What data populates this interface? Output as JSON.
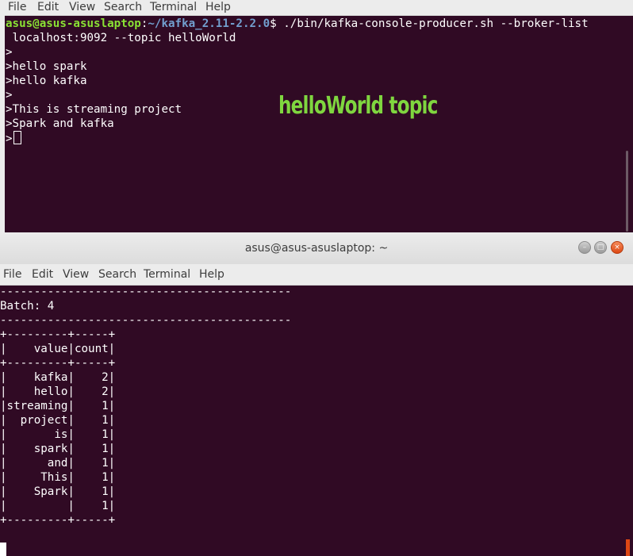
{
  "top_terminal": {
    "menu": [
      "File",
      "Edit",
      "View",
      "Search",
      "Terminal",
      "Help"
    ],
    "prompt_user": "asus@asus-asuslaptop",
    "prompt_sep": ":",
    "prompt_path": "~/kafka_2.11-2.2.0",
    "prompt_dollar": "$ ",
    "command": "./bin/kafka-console-producer.sh --broker-list",
    "command_cont": " localhost:9092 --topic helloWorld",
    "lines": [
      ">",
      ">hello spark",
      ">hello kafka",
      ">",
      ">This is streaming project",
      ">Spark and kafka"
    ],
    "last_prompt": ">",
    "overlay_label": "helloWorld topic"
  },
  "bottom_window": {
    "title": "asus@asus-asuslaptop: ~",
    "buttons": {
      "minimize": "–",
      "maximize": "□",
      "close": "×"
    },
    "menu": [
      "File",
      "Edit",
      "View",
      "Search",
      "Terminal",
      "Help"
    ],
    "output_lines": [
      "-------------------------------------------",
      "Batch: 4",
      "-------------------------------------------",
      "+---------+-----+",
      "|    value|count|",
      "+---------+-----+",
      "|    kafka|    2|",
      "|    hello|    2|",
      "|streaming|    1|",
      "|  project|    1|",
      "|       is|    1|",
      "|    spark|    1|",
      "|      and|    1|",
      "|     This|    1|",
      "|    Spark|    1|",
      "|         |    1|",
      "+---------+-----+"
    ]
  }
}
